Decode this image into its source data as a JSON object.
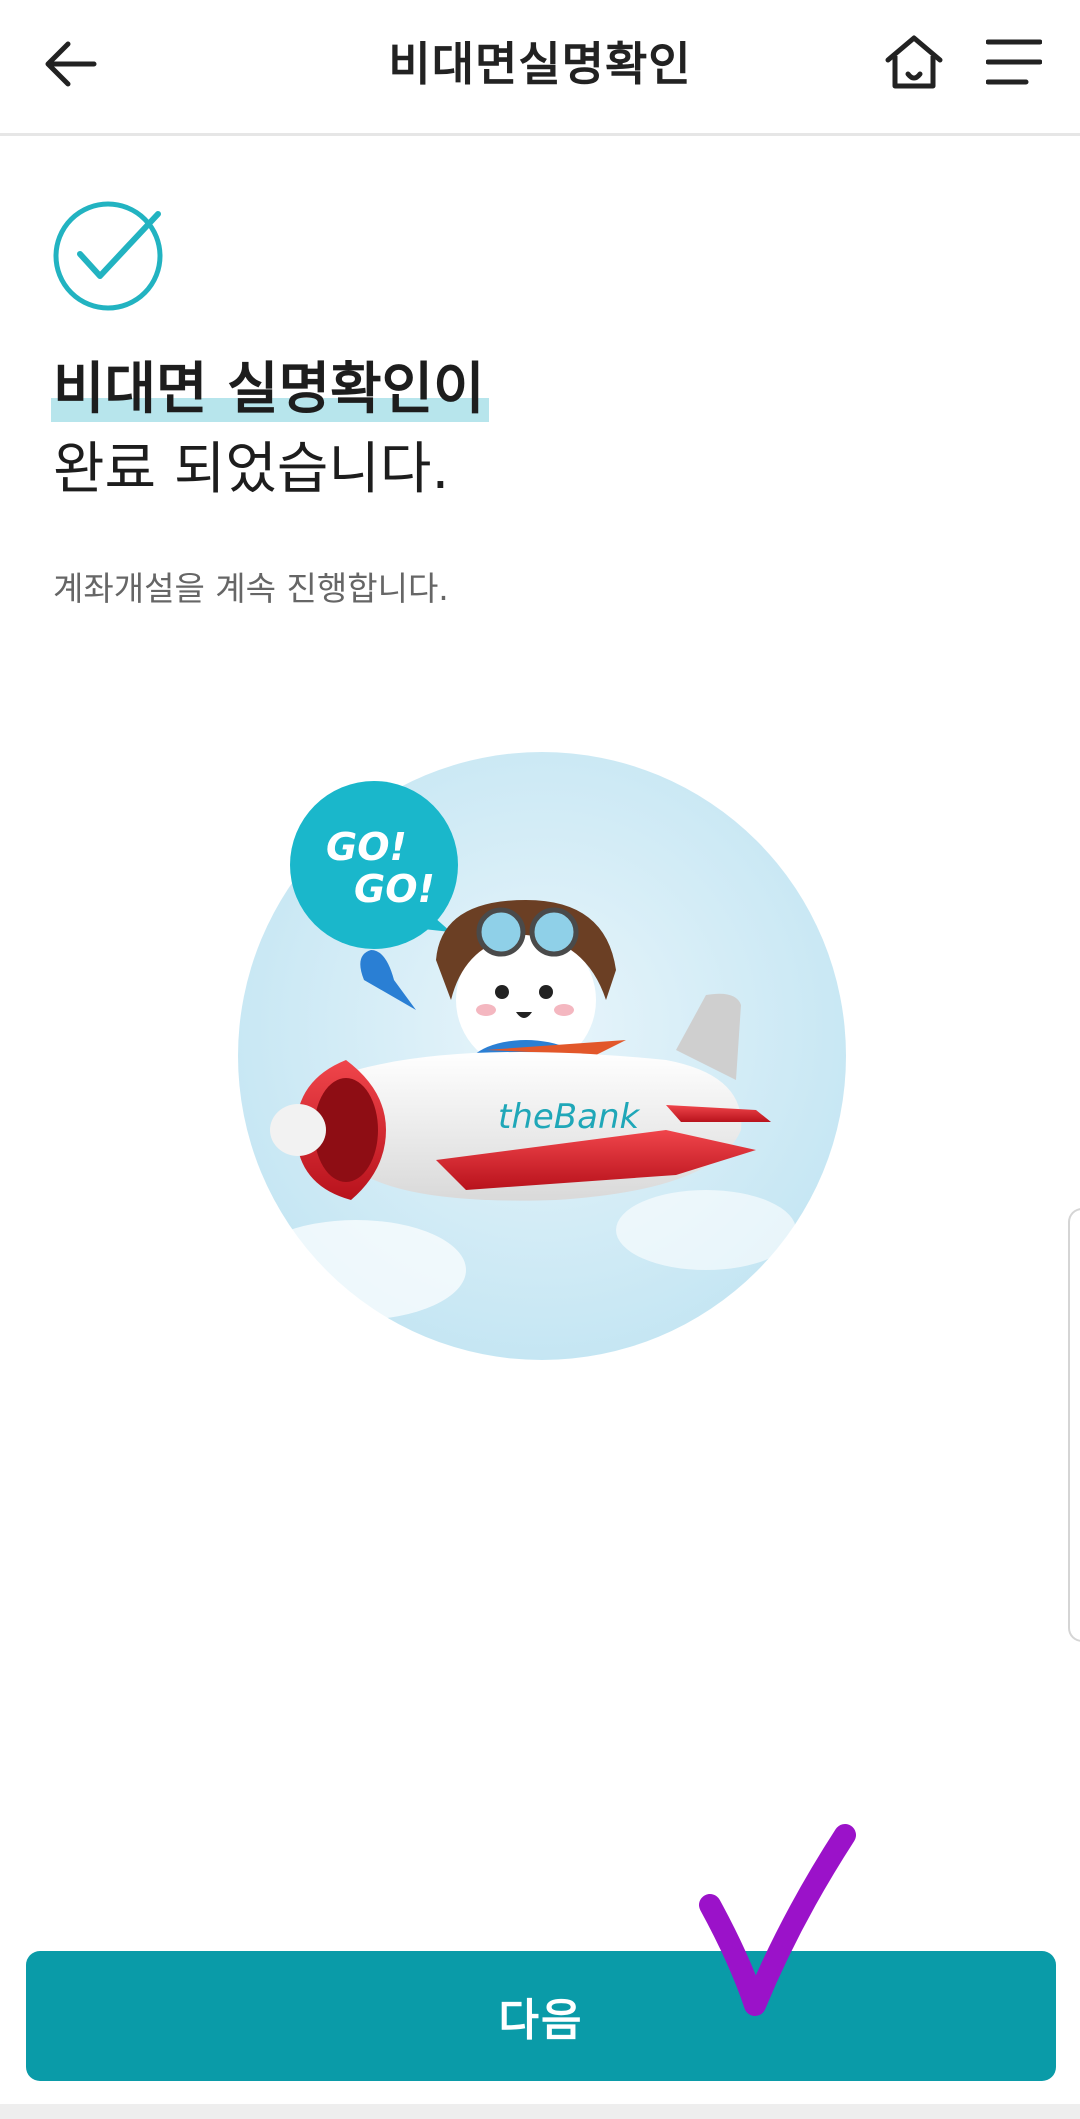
{
  "header": {
    "title": "비대면실명확인",
    "back_icon": "arrow-left-icon",
    "home_icon": "home-icon",
    "menu_icon": "hamburger-menu-icon"
  },
  "status": {
    "icon": "check-circle-icon",
    "heading_line1": "비대면 실명확인이",
    "heading_line2": "완료 되었습니다.",
    "subtext": "계좌개설을 계속 진행합니다."
  },
  "illustration": {
    "bubble_text_1": "GO!",
    "bubble_text_2": "GO!",
    "plane_logo": "theBank"
  },
  "actions": {
    "next_label": "다음"
  },
  "colors": {
    "accent": "#0a9ba8",
    "highlight": "#b7e5ec",
    "check": "#22b3c1",
    "annotation": "#9b12c9"
  }
}
